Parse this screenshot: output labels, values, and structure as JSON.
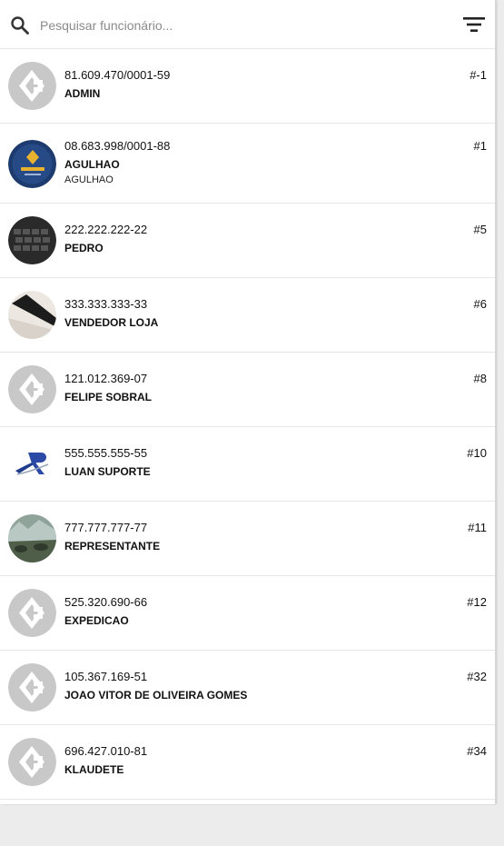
{
  "search": {
    "placeholder": "Pesquisar funcionário..."
  },
  "colors": {
    "accent": "#1f4e9c",
    "default_avatar": "#c8c8c8"
  },
  "employees": [
    {
      "document": "81.609.470/0001-59",
      "name": "ADMIN",
      "subtitle": "",
      "code": "#-1",
      "avatar": "default-logo"
    },
    {
      "document": "08.683.998/0001-88",
      "name": "AGULHAO",
      "subtitle": "AGULHAO",
      "code": "#1",
      "avatar": "agulhao-logo"
    },
    {
      "document": "222.222.222-22",
      "name": "PEDRO",
      "subtitle": "",
      "code": "#5",
      "avatar": "keyboard-photo"
    },
    {
      "document": "333.333.333-33",
      "name": "VENDEDOR LOJA",
      "subtitle": "",
      "code": "#6",
      "avatar": "laptop-photo"
    },
    {
      "document": "121.012.369-07",
      "name": "FELIPE SOBRAL",
      "subtitle": "",
      "code": "#8",
      "avatar": "default-logo"
    },
    {
      "document": "555.555.555-55",
      "name": "LUAN SUPORTE",
      "subtitle": "",
      "code": "#10",
      "avatar": "sr-logo"
    },
    {
      "document": "777.777.777-77",
      "name": "REPRESENTANTE",
      "subtitle": "",
      "code": "#11",
      "avatar": "landscape-photo"
    },
    {
      "document": "525.320.690-66",
      "name": "EXPEDICAO",
      "subtitle": "",
      "code": "#12",
      "avatar": "default-logo"
    },
    {
      "document": "105.367.169-51",
      "name": "JOAO VITOR DE OLIVEIRA GOMES",
      "subtitle": "",
      "code": "#32",
      "avatar": "default-logo"
    },
    {
      "document": "696.427.010-81",
      "name": "KLAUDETE",
      "subtitle": "",
      "code": "#34",
      "avatar": "default-logo"
    }
  ]
}
